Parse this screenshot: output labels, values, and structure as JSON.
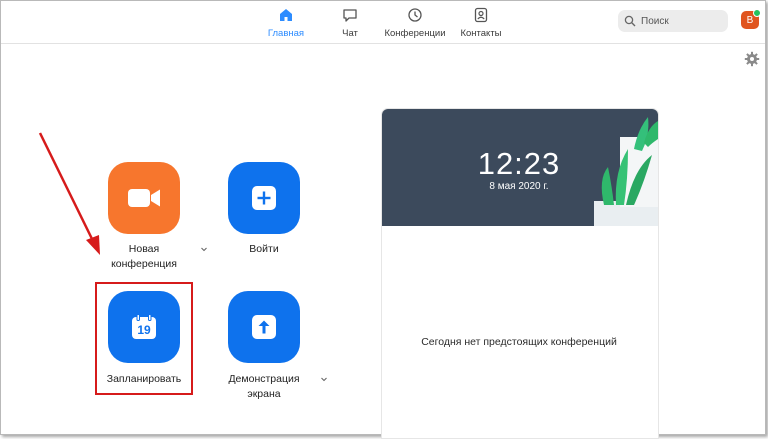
{
  "nav": {
    "home": "Главная",
    "chat": "Чат",
    "meetings": "Конференции",
    "contacts": "Контакты"
  },
  "search": {
    "label": "Поиск"
  },
  "avatar": {
    "initial": "В",
    "status_color": "#25c25e"
  },
  "actions": {
    "new_meeting_line1": "Новая",
    "new_meeting_line2": "конференция",
    "join": "Войти",
    "schedule": "Запланировать",
    "schedule_day": "19",
    "share_line1": "Демонстрация",
    "share_line2": "экрана"
  },
  "clock": {
    "time": "12:23",
    "date": "8 мая 2020 г."
  },
  "meetings": {
    "empty_text": "Сегодня нет предстоящих конференций"
  },
  "colors": {
    "accent": "#2d8cff",
    "blue_tile": "#0e72ed",
    "orange_tile": "#f7762d",
    "annotation_red": "#d61b1b"
  }
}
